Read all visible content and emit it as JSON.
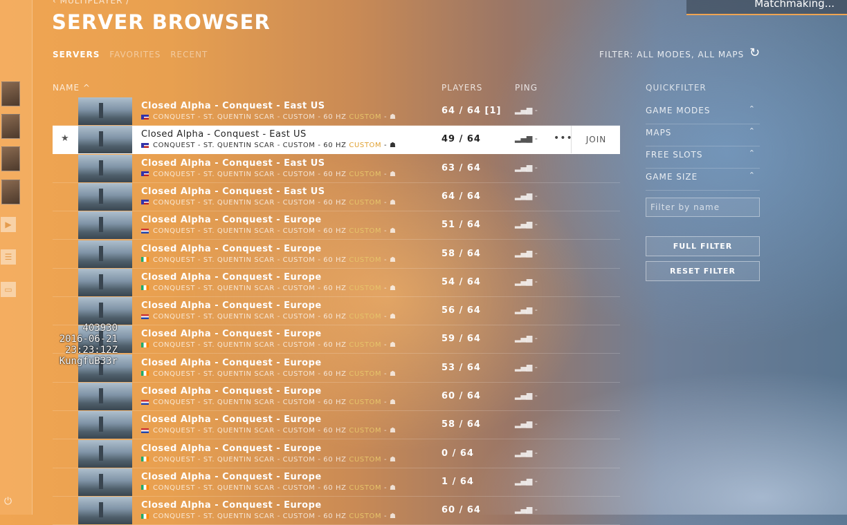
{
  "breadcrumb": "MULTIPLAYER  /",
  "page_title": "SERVER BROWSER",
  "tabs": [
    {
      "label": "SERVERS",
      "active": true
    },
    {
      "label": "FAVORITES",
      "active": false
    },
    {
      "label": "RECENT",
      "active": false
    }
  ],
  "filter_summary": "FILTER: ALL MODES, ALL MAPS",
  "matchmaking_label": "Matchmaking...",
  "columns": {
    "name": "NAME ^",
    "players": "PLAYERS",
    "ping": "PING"
  },
  "servers": [
    {
      "name": "Closed Alpha - Conquest - East US",
      "region": "US",
      "details": "CONQUEST - ST. QUENTIN SCAR - CUSTOM - 60 HZ",
      "custom": "CUSTOM",
      "badge": "- ☗",
      "players": "64 / 64 [1]",
      "ping": "▂▄▆ -"
    },
    {
      "name": "Closed Alpha - Conquest - East US",
      "region": "US",
      "details": "CONQUEST - ST. QUENTIN SCAR - CUSTOM - 60 HZ",
      "custom": "CUSTOM",
      "badge": "- ☗",
      "players": "49 / 64",
      "ping": "▂▄▆ -"
    },
    {
      "name": "Closed Alpha - Conquest - East US",
      "region": "US",
      "details": "CONQUEST - ST. QUENTIN SCAR - CUSTOM - 60 HZ",
      "custom": "CUSTOM",
      "badge": "- ☗",
      "players": "63 / 64",
      "ping": "▂▄▆ -"
    },
    {
      "name": "Closed Alpha - Conquest - East US",
      "region": "US",
      "details": "CONQUEST - ST. QUENTIN SCAR - CUSTOM - 60 HZ",
      "custom": "CUSTOM",
      "badge": "- ☗",
      "players": "64 / 64",
      "ping": "▂▄▆ -"
    },
    {
      "name": "Closed Alpha - Conquest - Europe",
      "region": "NL",
      "details": "CONQUEST - ST. QUENTIN SCAR - CUSTOM - 60 HZ",
      "custom": "CUSTOM",
      "badge": "- ☗",
      "players": "51 / 64",
      "ping": "▂▄▆ -"
    },
    {
      "name": "Closed Alpha - Conquest - Europe",
      "region": "IE",
      "details": "CONQUEST - ST. QUENTIN SCAR - CUSTOM - 60 HZ",
      "custom": "CUSTOM",
      "badge": "- ☗",
      "players": "58 / 64",
      "ping": "▂▄▆ -"
    },
    {
      "name": "Closed Alpha - Conquest - Europe",
      "region": "IE",
      "details": "CONQUEST - ST. QUENTIN SCAR - CUSTOM - 60 HZ",
      "custom": "CUSTOM",
      "badge": "- ☗",
      "players": "54 / 64",
      "ping": "▂▄▆ -"
    },
    {
      "name": "Closed Alpha - Conquest - Europe",
      "region": "NL",
      "details": "CONQUEST - ST. QUENTIN SCAR - CUSTOM - 60 HZ",
      "custom": "CUSTOM",
      "badge": "- ☗",
      "players": "56 / 64",
      "ping": "▂▄▆ -"
    },
    {
      "name": "Closed Alpha - Conquest - Europe",
      "region": "IE",
      "details": "CONQUEST - ST. QUENTIN SCAR - CUSTOM - 60 HZ",
      "custom": "CUSTOM",
      "badge": "- ☗",
      "players": "59 / 64",
      "ping": "▂▄▆ -"
    },
    {
      "name": "Closed Alpha - Conquest - Europe",
      "region": "IE",
      "details": "CONQUEST - ST. QUENTIN SCAR - CUSTOM - 60 HZ",
      "custom": "CUSTOM",
      "badge": "- ☗",
      "players": "53 / 64",
      "ping": "▂▄▆ -"
    },
    {
      "name": "Closed Alpha - Conquest - Europe",
      "region": "NL",
      "details": "CONQUEST - ST. QUENTIN SCAR - CUSTOM - 60 HZ",
      "custom": "CUSTOM",
      "badge": "- ☗",
      "players": "60 / 64",
      "ping": "▂▄▆ -"
    },
    {
      "name": "Closed Alpha - Conquest - Europe",
      "region": "NL",
      "details": "CONQUEST - ST. QUENTIN SCAR - CUSTOM - 60 HZ",
      "custom": "CUSTOM",
      "badge": "- ☗",
      "players": "58 / 64",
      "ping": "▂▄▆ -"
    },
    {
      "name": "Closed Alpha - Conquest - Europe",
      "region": "IE",
      "details": "CONQUEST - ST. QUENTIN SCAR - CUSTOM - 60 HZ",
      "custom": "CUSTOM",
      "badge": "- ☗",
      "players": "0 / 64",
      "ping": "▂▄▆ -"
    },
    {
      "name": "Closed Alpha - Conquest - Europe",
      "region": "IE",
      "details": "CONQUEST - ST. QUENTIN SCAR - CUSTOM - 60 HZ",
      "custom": "CUSTOM",
      "badge": "- ☗",
      "players": "1 / 64",
      "ping": "▂▄▆ -"
    },
    {
      "name": "Closed Alpha - Conquest - Europe",
      "region": "IE",
      "details": "CONQUEST - ST. QUENTIN SCAR - CUSTOM - 60 HZ",
      "custom": "CUSTOM",
      "badge": "- ☗",
      "players": "60 / 64",
      "ping": "▂▄▆ -"
    }
  ],
  "selected_row": {
    "favorite_icon": "★",
    "more_icon": "•••",
    "join_label": "JOIN"
  },
  "quickfilter": {
    "title": "QUICKFILTER",
    "items": [
      "GAME MODES",
      "MAPS",
      "FREE SLOTS",
      "GAME SIZE"
    ],
    "filter_placeholder": "Filter by name",
    "full_filter_label": "FULL FILTER",
    "reset_filter_label": "RESET FILTER"
  },
  "overlay_text": [
    "403930",
    "2016-06-21",
    "23:23:12Z",
    "KungfuB33r"
  ],
  "colors": {
    "accent": "#f0a552",
    "custom_tag": "#e6c46a"
  }
}
